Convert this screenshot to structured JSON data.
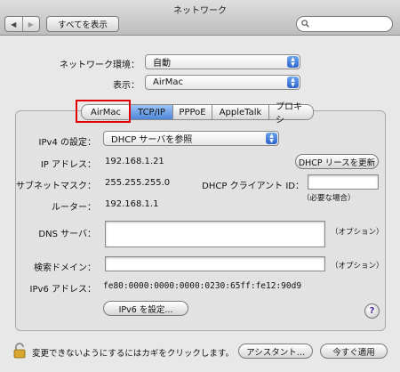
{
  "window": {
    "title": "ネットワーク"
  },
  "toolbar": {
    "back_glyph": "◀",
    "forward_glyph": "▶",
    "show_all_label": "すべてを表示",
    "search_value": ""
  },
  "location": {
    "label": "ネットワーク環境：",
    "value": "自動"
  },
  "show": {
    "label": "表示：",
    "value": "AirMac"
  },
  "tabs": [
    {
      "label": "AirMac",
      "selected": false
    },
    {
      "label": "TCP/IP",
      "selected": true
    },
    {
      "label": "PPPoE",
      "selected": false
    },
    {
      "label": "AppleTalk",
      "selected": false
    },
    {
      "label": "プロキシ",
      "selected": false
    }
  ],
  "ipv4": {
    "label": "IPv4 の設定：",
    "value": "DHCP サーバを参照"
  },
  "ip_address": {
    "label": "IP アドレス：",
    "value": "192.168.1.21"
  },
  "renew_dhcp_label": "DHCP リースを更新",
  "subnet": {
    "label": "サブネットマスク：",
    "value": "255.255.255.0"
  },
  "dhcp_client_id": {
    "label": "DHCP クライアント ID：",
    "value": "",
    "hint": "（必要な場合）"
  },
  "router": {
    "label": "ルーター：",
    "value": "192.168.1.1"
  },
  "dns": {
    "label": "DNS サーバ：",
    "value": "",
    "hint": "（オプション）"
  },
  "search_domain": {
    "label": "検索ドメイン：",
    "value": "",
    "hint": "（オプション）"
  },
  "ipv6": {
    "label": "IPv6 アドレス：",
    "value": "fe80:0000:0000:0000:0230:65ff:fe12:90d9"
  },
  "configure_ipv6_label": "IPv6 を設定...",
  "help_label": "?",
  "footer": {
    "lock_text": "変更できないようにするにはカギをクリックします。",
    "assistant_label": "アシスタント...",
    "apply_label": "今すぐ適用"
  }
}
